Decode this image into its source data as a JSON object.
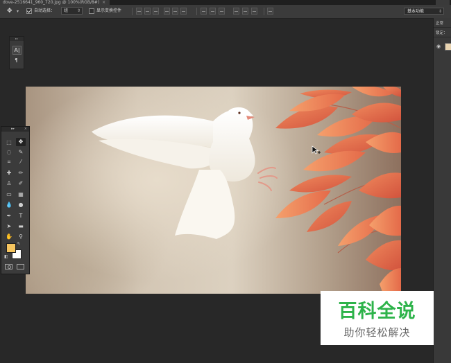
{
  "document_tab": {
    "title": "dove-2516641_960_720.jpg @ 100%(RGB/8#)",
    "close": "×"
  },
  "options_bar": {
    "tool_dropdown_arrow": "▾",
    "auto_select_label": "自动选择：",
    "auto_select_checked": true,
    "auto_select_target": "组",
    "show_transform_label": "显示变换控件",
    "show_transform_checked": false,
    "workspace": "基本功能"
  },
  "right_dock": {
    "row1": "正常",
    "row2": "锁定："
  },
  "toolbox": {
    "expand": "▸▸",
    "close": "×",
    "foreground_color": "#f6c55f",
    "background_color": "#ffffff"
  },
  "icons": {
    "move_tool": "move-icon",
    "character_panel": "character-panel-icon",
    "paragraph_panel": "paragraph-panel-icon",
    "eye": "eye-icon",
    "cursor": "move-cursor-icon"
  },
  "canvas": {
    "subject": "white dove with orange leaves",
    "leaf_color": "#e36b4b"
  },
  "watermark": {
    "title": "百科全说",
    "subtitle": "助你轻松解决",
    "title_color": "#2db34a"
  }
}
